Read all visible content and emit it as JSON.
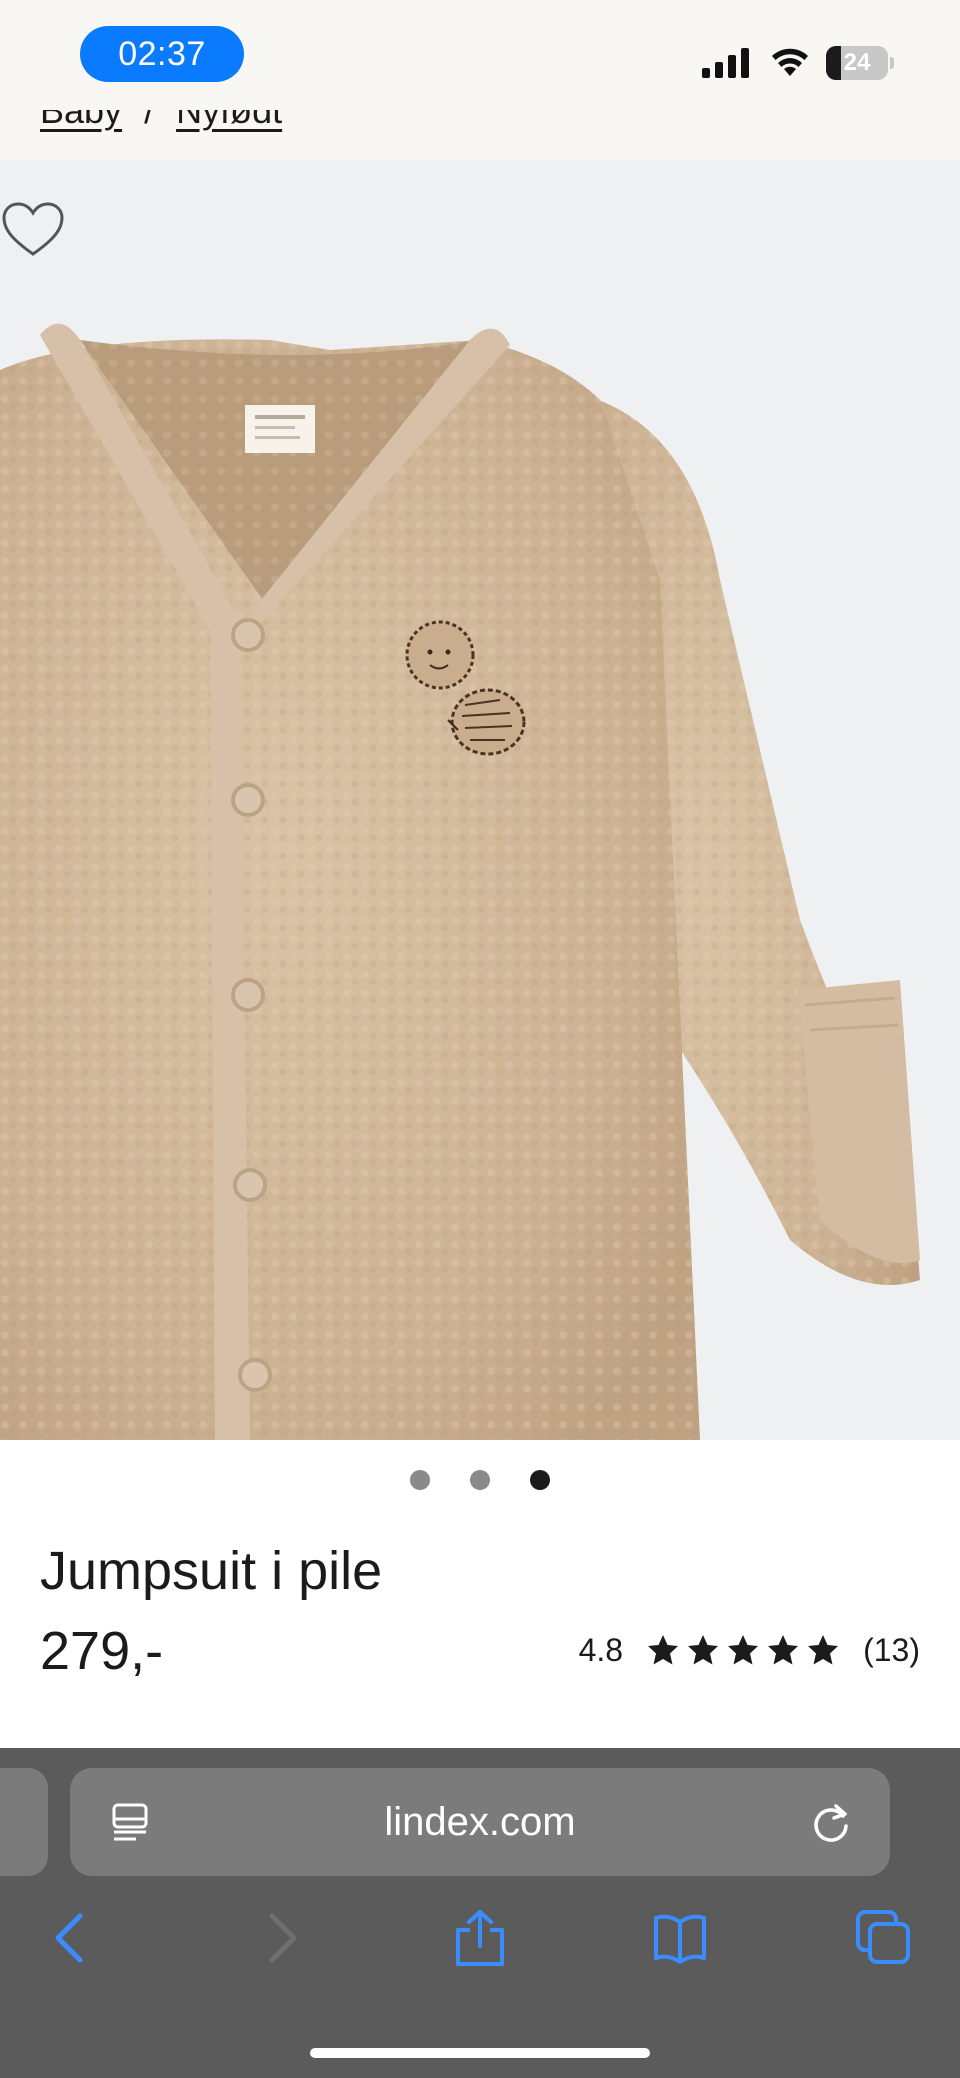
{
  "status_bar": {
    "time": "02:37",
    "battery_level": "24",
    "battery_fraction": 0.24,
    "time_pill_color": "#0a7aff"
  },
  "breadcrumb": {
    "items": [
      "Baby",
      "Nyfødt"
    ],
    "separator": "/"
  },
  "gallery": {
    "current_index": 3,
    "total": 3,
    "wishlist_icon": "heart-outline-icon"
  },
  "product": {
    "name": "Jumpsuit i pile",
    "price": "279,-",
    "rating": "4.8",
    "rating_stars": 5,
    "review_count": "(13)"
  },
  "browser": {
    "url": "lindex.com",
    "reader_icon": "reader-mode-icon",
    "reload_icon": "reload-icon",
    "toolbar_icons": [
      "back-icon",
      "forward-icon",
      "share-icon",
      "bookmarks-icon",
      "tabs-icon"
    ],
    "accent_color": "#3a8dff"
  }
}
